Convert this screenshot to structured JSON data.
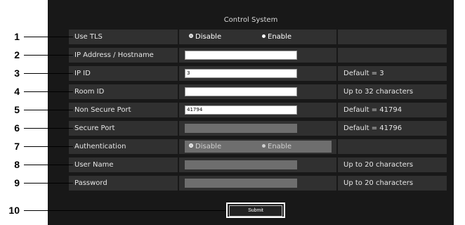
{
  "title": "Control System",
  "rows": [
    {
      "num": "1",
      "label": "Use TLS",
      "type": "radio",
      "options": [
        "Disable",
        "Enable"
      ],
      "selected": "Disable",
      "disabled": false,
      "note": ""
    },
    {
      "num": "2",
      "label": "IP Address / Hostname",
      "type": "text",
      "value": "",
      "disabled": false,
      "note": ""
    },
    {
      "num": "3",
      "label": "IP ID",
      "type": "text",
      "value": "3",
      "disabled": false,
      "note": "Default = 3"
    },
    {
      "num": "4",
      "label": "Room ID",
      "type": "text",
      "value": "",
      "disabled": false,
      "note": "Up to 32 characters"
    },
    {
      "num": "5",
      "label": "Non Secure Port",
      "type": "text",
      "value": "41794",
      "disabled": false,
      "note": "Default = 41794"
    },
    {
      "num": "6",
      "label": "Secure Port",
      "type": "text",
      "value": "",
      "disabled": true,
      "note": "Default = 41796"
    },
    {
      "num": "7",
      "label": "Authentication",
      "type": "radio",
      "options": [
        "Disable",
        "Enable"
      ],
      "selected": "Disable",
      "disabled": true,
      "note": ""
    },
    {
      "num": "8",
      "label": "User Name",
      "type": "text",
      "value": "",
      "disabled": true,
      "note": "Up to 20 characters"
    },
    {
      "num": "9",
      "label": "Password",
      "type": "text",
      "value": "",
      "disabled": true,
      "note": "Up to 20 characters"
    }
  ],
  "submit": {
    "num": "10",
    "label": "Submit"
  }
}
